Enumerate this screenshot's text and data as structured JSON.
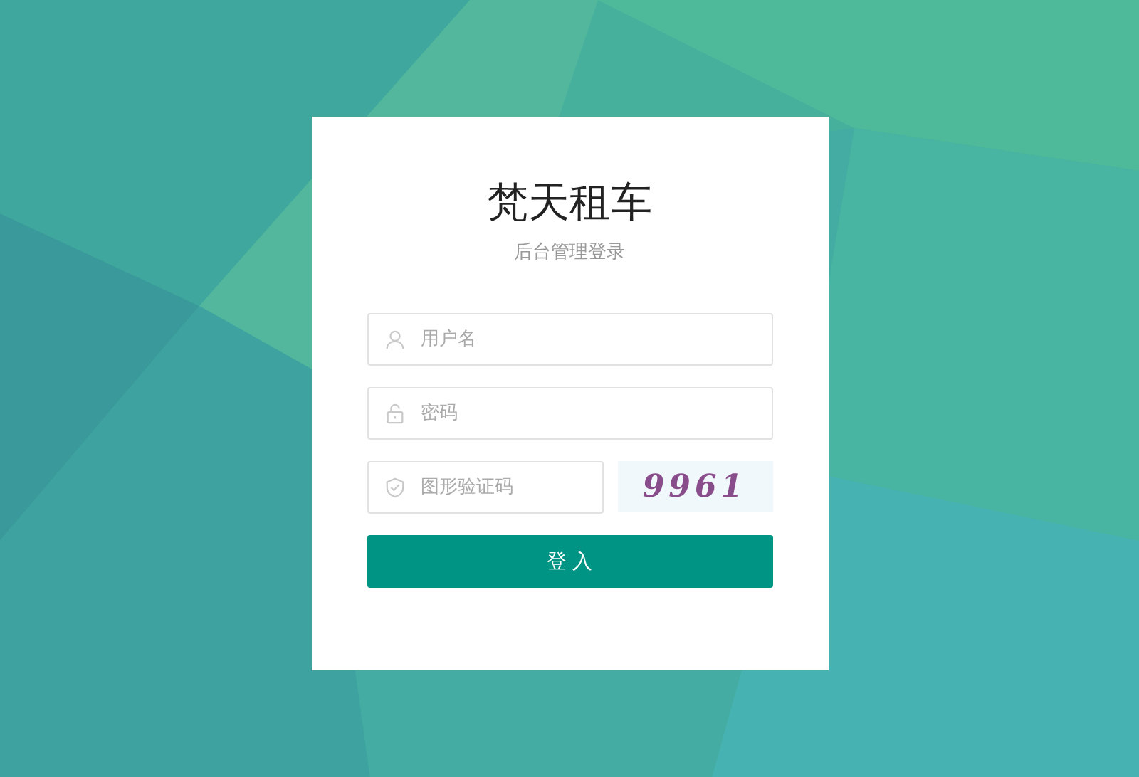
{
  "login": {
    "title": "梵天租车",
    "subtitle": "后台管理登录",
    "fields": [
      {
        "kind": "user",
        "placeholder": "用户名"
      },
      {
        "kind": "lock",
        "placeholder": "密码"
      },
      {
        "kind": "shield",
        "placeholder": "图形验证码"
      }
    ],
    "captcha": "9961",
    "button": "登 入"
  }
}
